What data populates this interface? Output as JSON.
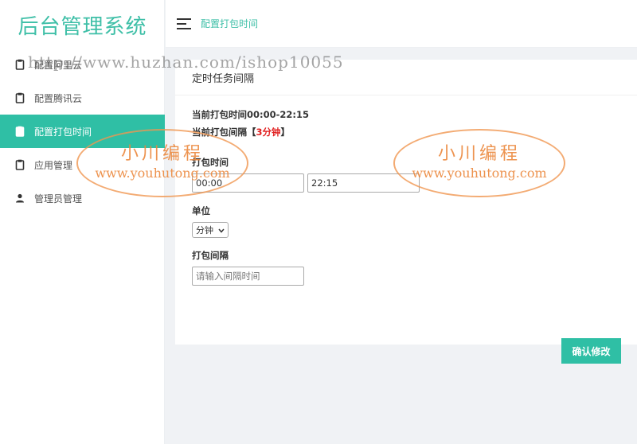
{
  "app": {
    "title": "后台管理系统"
  },
  "sidebar": {
    "items": [
      {
        "label": "配置阿里云",
        "icon": "clipboard-icon",
        "active": false
      },
      {
        "label": "配置腾讯云",
        "icon": "clipboard-icon",
        "active": false
      },
      {
        "label": "配置打包时间",
        "icon": "clipboard-icon",
        "active": true
      },
      {
        "label": "应用管理",
        "icon": "clipboard-icon",
        "active": false
      },
      {
        "label": "管理员管理",
        "icon": "user-icon",
        "active": false
      }
    ]
  },
  "header": {
    "breadcrumb": "配置打包时间"
  },
  "card": {
    "title": "定时任务间隔",
    "current_time_label": "当前打包时间00:00-22:15",
    "current_interval_prefix": "当前打包间隔【",
    "current_interval_value": "3分钟",
    "current_interval_suffix": "】",
    "pack_time_label": "打包时间",
    "start_time": "00:00",
    "end_time": "22:15",
    "unit_label": "单位",
    "unit_selected": "分钟",
    "interval_label": "打包间隔",
    "interval_placeholder": "请输入间隔时间",
    "submit_label": "确认修改"
  },
  "watermarks": {
    "url": "http://www.huzhan.com/ishop10055",
    "stamp_cn": "小川编程",
    "stamp_en": "www.youhutong.com"
  },
  "colors": {
    "accent": "#2fbfa5",
    "brand": "#3ebfa7",
    "highlight": "#e02020"
  }
}
